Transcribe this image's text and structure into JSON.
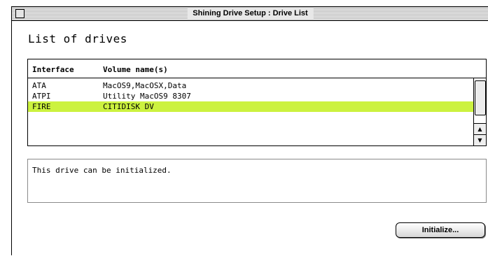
{
  "window": {
    "title": "Shining Drive Setup : Drive List"
  },
  "heading": "List of drives",
  "table": {
    "columns": [
      "Interface",
      "Volume name(s)"
    ],
    "rows": [
      {
        "interface": "ATA",
        "volumes": "MacOS9,MacOSX,Data",
        "selected": false
      },
      {
        "interface": "ATPI",
        "volumes": "Utility MacOS9 8307",
        "selected": false
      },
      {
        "interface": "FIRE",
        "volumes": "CITIDISK DV",
        "selected": true
      }
    ]
  },
  "status_message": "This drive can be initialized.",
  "buttons": {
    "initialize": "Initialize..."
  },
  "colors": {
    "selection": "#ccf23f"
  }
}
